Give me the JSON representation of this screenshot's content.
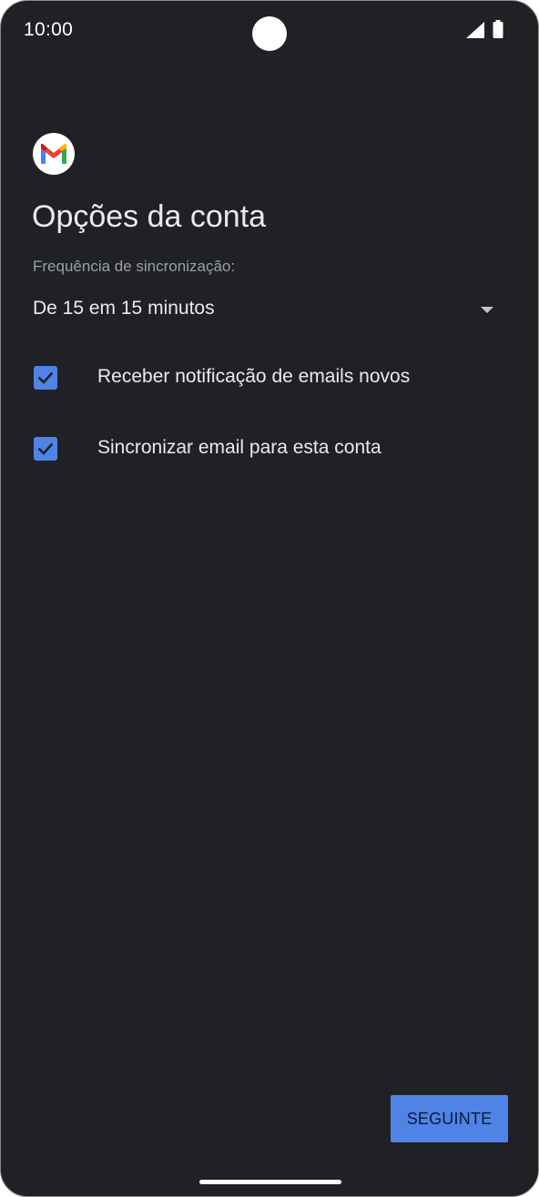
{
  "status_bar": {
    "time": "10:00",
    "signal_icon": "cellular-signal-icon",
    "battery_icon": "battery-full-icon"
  },
  "app": {
    "logo_icon": "gmail-logo-icon"
  },
  "page": {
    "title": "Opções da conta"
  },
  "sync_frequency": {
    "label": "Frequência de sincronização:",
    "selected_value": "De 15 em 15 minutos",
    "arrow_icon": "dropdown-arrow-icon"
  },
  "options": [
    {
      "label": "Receber notificação de emails novos",
      "checked": true
    },
    {
      "label": "Sincronizar email para esta conta",
      "checked": true
    }
  ],
  "actions": {
    "next_label": "SEGUINTE"
  },
  "colors": {
    "background": "#202124",
    "accent": "#4f83e6",
    "primary_text": "#e8eaed",
    "secondary_text": "#9aa0a6"
  }
}
